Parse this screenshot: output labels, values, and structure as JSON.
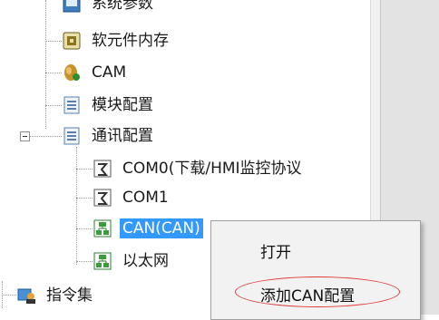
{
  "tree": {
    "items": [
      {
        "label": "系统参数",
        "icon": "system-params-icon"
      },
      {
        "label": "软元件内存",
        "icon": "device-memory-icon"
      },
      {
        "label": "CAM",
        "icon": "cam-icon"
      },
      {
        "label": "模块配置",
        "icon": "module-config-icon"
      },
      {
        "label": "通讯配置",
        "icon": "comm-config-icon"
      },
      {
        "label": "COM0(下载/HMI监控协议",
        "icon": "serial-port-icon"
      },
      {
        "label": "COM1",
        "icon": "serial-port-icon"
      },
      {
        "label": "CAN(CAN)",
        "icon": "network-icon"
      },
      {
        "label": "以太网",
        "icon": "network-icon"
      },
      {
        "label": "指令集",
        "icon": "instruction-set-icon"
      }
    ]
  },
  "context_menu": {
    "items": [
      {
        "label": "打开"
      },
      {
        "label": "添加CAN配置"
      }
    ]
  },
  "colors": {
    "selection": "#3399ff",
    "highlight_ring": "#e03a3a",
    "menu_bg": "#f2f2f2"
  }
}
